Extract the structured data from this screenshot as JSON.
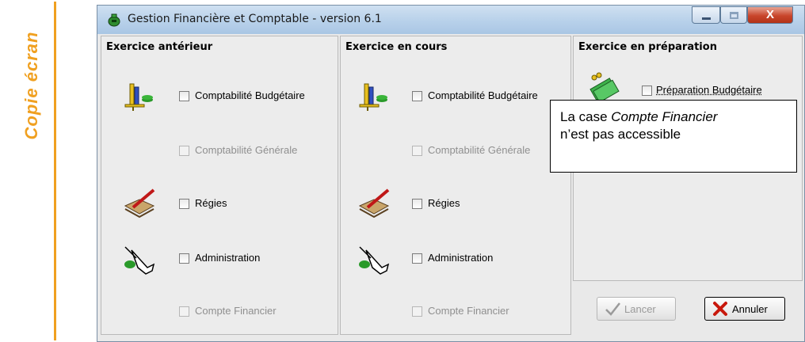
{
  "side_caption": "Copie écran",
  "window": {
    "title": "Gestion Financière et Comptable - version 6.1",
    "close_glyph": "X"
  },
  "panels": [
    {
      "title": "Exercice antérieur",
      "items": [
        {
          "label": "Comptabilité Budgétaire",
          "enabled": true
        },
        {
          "label": "Comptabilité Générale",
          "enabled": false
        },
        {
          "label": "Régies",
          "enabled": true
        },
        {
          "label": "Administration",
          "enabled": true
        },
        {
          "label": "Compte Financier",
          "enabled": false
        }
      ]
    },
    {
      "title": "Exercice en cours",
      "items": [
        {
          "label": "Comptabilité Budgétaire",
          "enabled": true
        },
        {
          "label": "Comptabilité Générale",
          "enabled": false
        },
        {
          "label": "Régies",
          "enabled": true
        },
        {
          "label": "Administration",
          "enabled": true
        },
        {
          "label": "Compte Financier",
          "enabled": false
        }
      ]
    },
    {
      "title": "Exercice en préparation",
      "items": [
        {
          "label": "Préparation Budgétaire",
          "enabled": true
        }
      ]
    }
  ],
  "callout": {
    "line1_prefix": "La case ",
    "line1_italic": "Compte Financier",
    "line2": "n’est pas accessible"
  },
  "buttons": {
    "launch": "Lancer",
    "cancel": "Annuler"
  },
  "colors": {
    "accent": "#f0a020",
    "window_bg": "#ececec",
    "close_red": "#c8452b"
  }
}
